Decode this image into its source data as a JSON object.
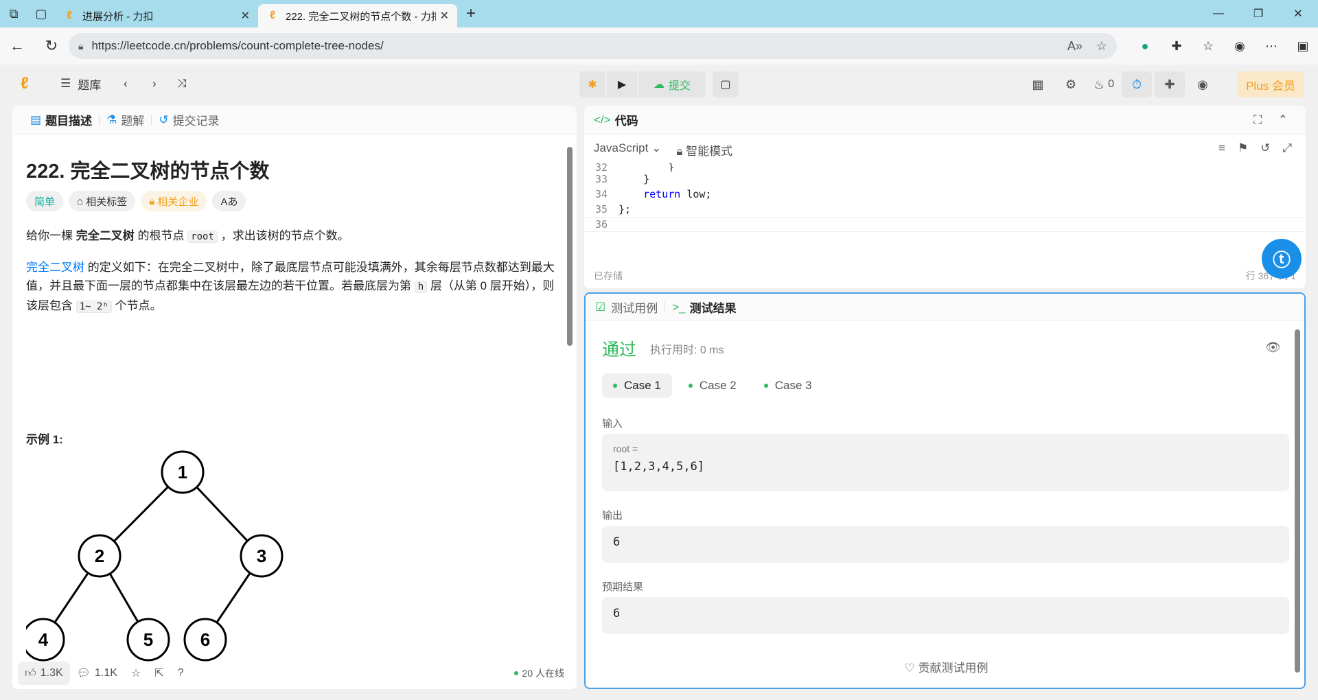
{
  "browser": {
    "tabs": [
      {
        "title": "进展分析 - 力扣"
      },
      {
        "title": "222. 完全二叉树的节点个数 - 力扣"
      }
    ],
    "url": "https://leetcode.cn/problems/count-complete-tree-nodes/"
  },
  "header": {
    "problem_list_label": "题库",
    "submit_label": "提交",
    "streak_count": "0",
    "plus_label": "Plus 会员"
  },
  "left_panel": {
    "tabs": [
      {
        "label": "题目描述"
      },
      {
        "label": "题解"
      },
      {
        "label": "提交记录"
      }
    ],
    "title": "222. 完全二叉树的节点个数",
    "tags": [
      {
        "label": "简单"
      },
      {
        "label": "相关标签"
      },
      {
        "label": "相关企业"
      },
      {
        "label": "Aあ"
      }
    ],
    "desc_line1_a": "给你一棵 ",
    "desc_line1_b": "完全二叉树",
    "desc_line1_c": " 的根节点 ",
    "desc_line1_code": "root",
    "desc_line1_d": " ，求出该树的节点个数。",
    "desc2_link": "完全二叉树",
    "desc2_a": " 的定义如下：在完全二叉树中，除了最底层节点可能没填满外，其余每层节点数都达到最大值，并且最下面一层的节点都集中在该层最左边的若干位置。若最底层为第 ",
    "desc2_h": "h",
    "desc2_b": " 层（从第 0 层开始），则该层包含 ",
    "desc2_range": "1~ 2ʰ",
    "desc2_c": " 个节点。",
    "example_title": "示例 1:",
    "tree_nodes": [
      "1",
      "2",
      "3",
      "4",
      "5",
      "6"
    ],
    "likes": "1.3K",
    "comments": "1.1K",
    "online": "20 人在线"
  },
  "code_panel": {
    "title": "代码",
    "language": "JavaScript",
    "mode": "智能模式",
    "lines": [
      {
        "n": "32",
        "t": "        }"
      },
      {
        "n": "33",
        "t": "    }"
      },
      {
        "n": "34",
        "t": "    return low;"
      },
      {
        "n": "35",
        "t": "};"
      },
      {
        "n": "36",
        "t": ""
      }
    ],
    "saved": "已存储",
    "position": "行 36，列 1"
  },
  "result_panel": {
    "tab_testcase": "测试用例",
    "tab_result": "测试结果",
    "status": "通过",
    "runtime": "执行用时: 0 ms",
    "cases": [
      {
        "label": "Case 1"
      },
      {
        "label": "Case 2"
      },
      {
        "label": "Case 3"
      }
    ],
    "input_label": "输入",
    "input_var": "root =",
    "input_value": "[1,2,3,4,5,6]",
    "output_label": "输出",
    "output_value": "6",
    "expected_label": "预期结果",
    "expected_value": "6",
    "contribute_label": "贡献测试用例"
  },
  "colors": {
    "titlebar": "#a6dcec",
    "accent_green": "#2cbb5d",
    "easy": "#00af9b",
    "brand_orange": "#f0a020",
    "link": "#007aff"
  }
}
